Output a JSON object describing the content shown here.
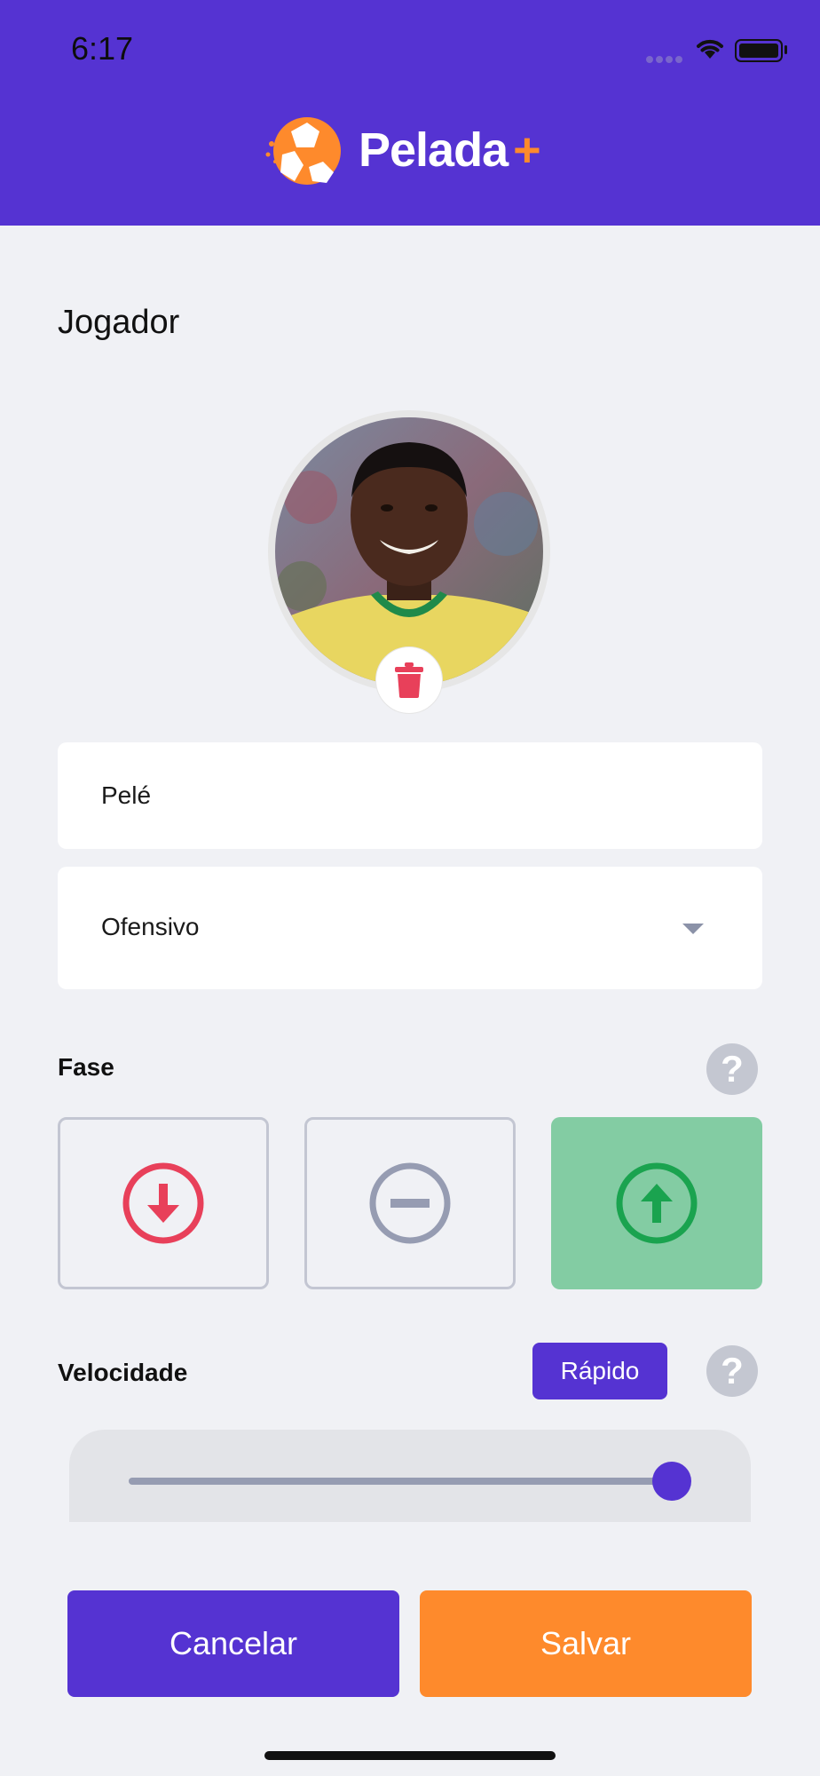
{
  "status_bar": {
    "time": "6:17"
  },
  "app": {
    "name": "Pelada",
    "plus": "+"
  },
  "page": {
    "title": "Jogador"
  },
  "player": {
    "name": "Pelé",
    "position": "Ofensivo"
  },
  "phase": {
    "label": "Fase",
    "options": [
      "down",
      "neutral",
      "up"
    ],
    "selected": "up",
    "help": "?"
  },
  "speed": {
    "label": "Velocidade",
    "value_label": "Rápido",
    "level": 1.0,
    "help": "?"
  },
  "actions": {
    "cancel": "Cancelar",
    "save": "Salvar"
  },
  "colors": {
    "primary": "#5533d2",
    "accent": "#fe8a2c",
    "danger": "#e8405a",
    "success": "#1aa34f",
    "success_bg": "#83cca3",
    "neutral": "#969cb2"
  }
}
